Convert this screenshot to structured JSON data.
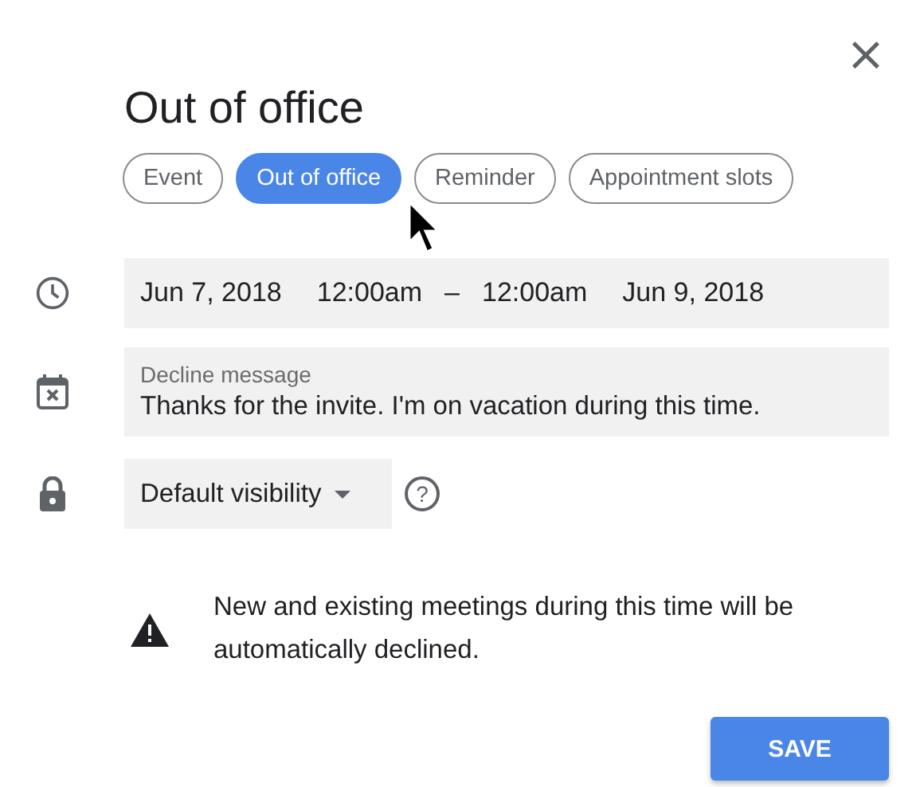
{
  "close_label": "×",
  "title": "Out of office",
  "tabs": [
    {
      "label": "Event",
      "selected": false
    },
    {
      "label": "Out of office",
      "selected": true
    },
    {
      "label": "Reminder",
      "selected": false
    },
    {
      "label": "Appointment slots",
      "selected": false
    }
  ],
  "date_row": {
    "start_date": "Jun 7, 2018",
    "start_time": "12:00am",
    "separator": "–",
    "end_time": "12:00am",
    "end_date": "Jun 9, 2018"
  },
  "decline_message": {
    "label": "Decline message",
    "value": "Thanks for the invite. I'm on vacation during this time."
  },
  "visibility": {
    "value": "Default visibility",
    "help": "?"
  },
  "warning": "New and existing meetings during this time will be automatically declined.",
  "save_button": "SAVE"
}
